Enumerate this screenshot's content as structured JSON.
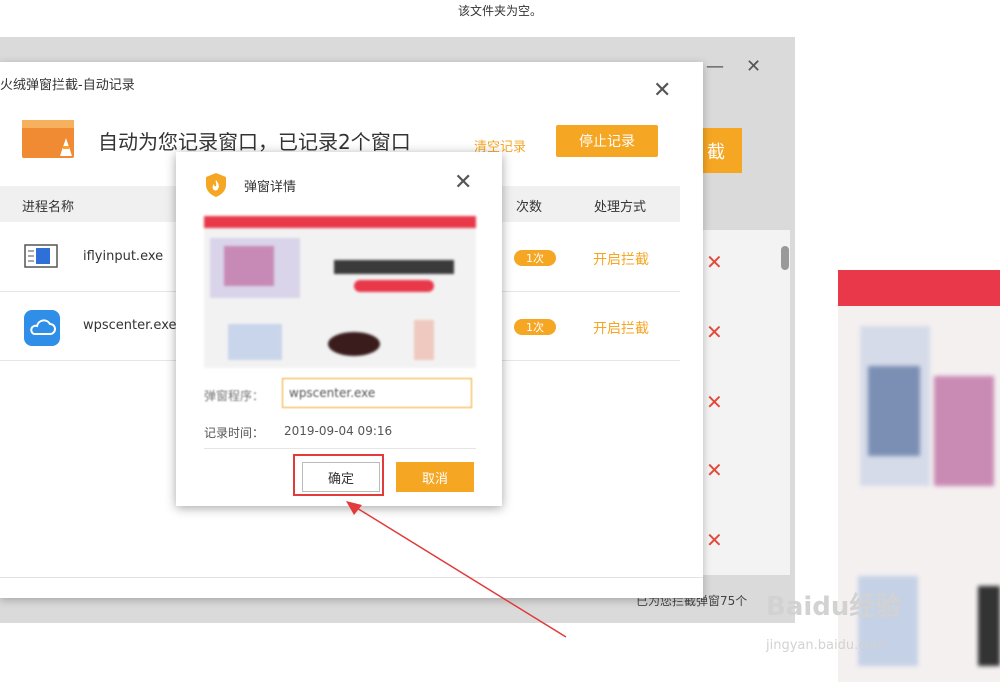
{
  "top_message": "该文件夹为空。",
  "background_window": {
    "minimize_icon": "minimize-icon",
    "close_icon": "close-icon",
    "orange_button_partial": "截",
    "bottom_left_partial": "  ",
    "bottom_right_partial": "已为您拦截弹窗75个"
  },
  "main_dialog": {
    "title": "火绒弹窗拦截-自动记录",
    "headline": "自动为您记录窗口，已记录2个窗口",
    "clear_link": "清空记录",
    "stop_button": "停止记录",
    "columns": {
      "name": "进程名称",
      "count": "次数",
      "action": "处理方式"
    },
    "rows": [
      {
        "name": "iflyinput.exe",
        "count": "1次",
        "action": "开启拦截",
        "icon": "keyboard-icon"
      },
      {
        "name": "wpscenter.exe",
        "count": "1次",
        "action": "开启拦截",
        "icon": "cloud-icon"
      }
    ]
  },
  "detail_dialog": {
    "title": "弹窗详情",
    "program_label": "弹窗程序：",
    "program_value": "wpscenter.exe",
    "time_label": "记录时间：",
    "time_value": "2019-09-04 09:16",
    "ok_button": "确定",
    "cancel_button": "取消"
  },
  "watermark": {
    "main": "Baidu经验",
    "sub": "jingyan.baidu.com"
  },
  "colors": {
    "accent": "#f5a623",
    "danger": "#e24b3b",
    "highlight": "#e23b3b"
  }
}
